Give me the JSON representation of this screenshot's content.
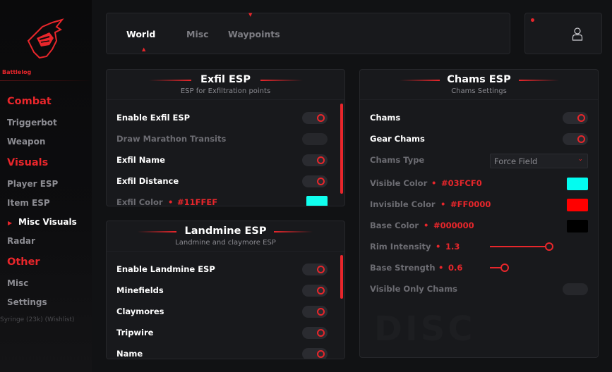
{
  "sidebar": {
    "brand": "Battlelog",
    "categories": {
      "combat": "Combat",
      "visuals": "Visuals",
      "other": "Other"
    },
    "items": {
      "triggerbot": "Triggerbot",
      "weapon": "Weapon",
      "player_esp": "Player ESP",
      "item_esp": "Item ESP",
      "misc_visuals": "Misc Visuals",
      "radar": "Radar",
      "misc": "Misc",
      "settings": "Settings"
    },
    "overlay_text": "Syringe (23k) (Wishlist)"
  },
  "tabs": {
    "world": "World",
    "misc": "Misc",
    "waypoints": "Waypoints",
    "active": "World"
  },
  "exfil": {
    "title": "Exfil ESP",
    "subtitle": "ESP for Exfiltration points",
    "rows": [
      {
        "label": "Enable Exfil ESP",
        "on": true
      },
      {
        "label": "Draw Marathon Transits",
        "on": false
      },
      {
        "label": "Exfil Name",
        "on": true
      },
      {
        "label": "Exfil Distance",
        "on": true
      }
    ],
    "color_label": "Exfil Color",
    "color_value": "#11FFEF"
  },
  "landmine": {
    "title": "Landmine ESP",
    "subtitle": "Landmine and claymore ESP",
    "rows": [
      {
        "label": "Enable Landmine ESP",
        "on": true
      },
      {
        "label": "Minefields",
        "on": true
      },
      {
        "label": "Claymores",
        "on": true
      },
      {
        "label": "Tripwire",
        "on": true
      },
      {
        "label": "Name",
        "on": true
      }
    ]
  },
  "chams": {
    "title": "Chams ESP",
    "subtitle": "Chams Settings",
    "chams_label": "Chams",
    "chams_on": true,
    "gear_label": "Gear Chams",
    "gear_on": true,
    "type_label": "Chams Type",
    "type_value": "Force Field",
    "visible_color_label": "Visible Color",
    "visible_color": "#03FCF0",
    "invisible_color_label": "Invisible Color",
    "invisible_color": "#FF0000",
    "base_color_label": "Base Color",
    "base_color": "#000000",
    "rim_label": "Rim Intensity",
    "rim_value": "1.3",
    "rim_fraction": 0.8,
    "base_strength_label": "Base Strength",
    "base_strength_value": "0.6",
    "base_strength_fraction": 0.2,
    "visible_only_label": "Visible Only Chams",
    "visible_only_on": false
  },
  "watermark": "DISC",
  "colors": {
    "accent": "#E8262B",
    "panel": "#18191C",
    "background": "#111214"
  }
}
